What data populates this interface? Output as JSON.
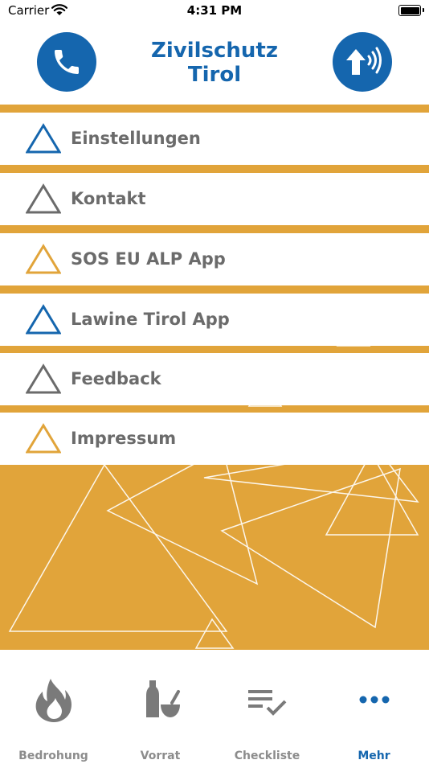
{
  "status_bar": {
    "carrier": "Carrier",
    "time": "4:31 PM"
  },
  "header": {
    "title_line1": "Zivilschutz",
    "title_line2": "Tirol",
    "call_icon": "phone-icon",
    "alarm_icon": "siren-signal-icon"
  },
  "colors": {
    "brand_blue": "#1566ae",
    "accent_orange": "#e1a43a",
    "label_gray": "#6b6b6b",
    "icon_gray": "#7a7a7a"
  },
  "menu": {
    "items": [
      {
        "label": "Einstellungen",
        "icon": "triangle-outline-icon",
        "icon_color": "#1566ae"
      },
      {
        "label": "Kontakt",
        "icon": "triangle-outline-icon",
        "icon_color": "#6b6b6b"
      },
      {
        "label": "SOS EU ALP App",
        "icon": "triangle-outline-icon",
        "icon_color": "#e1a43a"
      },
      {
        "label": "Lawine Tirol App",
        "icon": "triangle-outline-icon",
        "icon_color": "#1566ae"
      },
      {
        "label": "Feedback",
        "icon": "triangle-outline-icon",
        "icon_color": "#6b6b6b"
      },
      {
        "label": "Impressum",
        "icon": "triangle-outline-icon",
        "icon_color": "#e1a43a"
      }
    ]
  },
  "tab_bar": {
    "tabs": [
      {
        "label": "Bedrohung",
        "icon": "flame-icon",
        "active": false
      },
      {
        "label": "Vorrat",
        "icon": "bottle-mortar-icon",
        "active": false
      },
      {
        "label": "Checkliste",
        "icon": "checklist-icon",
        "active": false
      },
      {
        "label": "Mehr",
        "icon": "more-dots-icon",
        "active": true
      }
    ]
  }
}
